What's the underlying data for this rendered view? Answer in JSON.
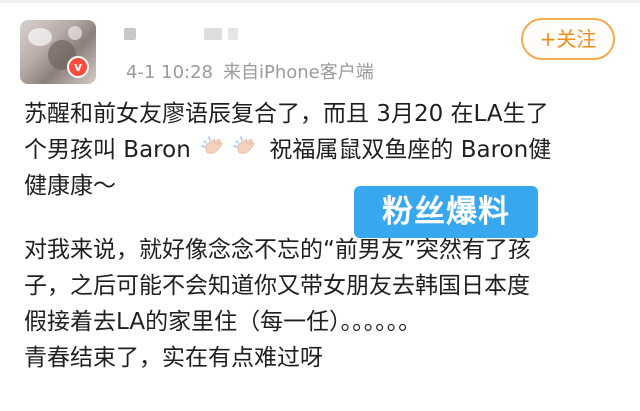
{
  "post": {
    "header": {
      "timestamp": "4-1 10:28",
      "source_prefix": "来自",
      "source_device": "iPhone客户端",
      "follow_label": "+关注"
    },
    "body": {
      "paragraph_1": {
        "line_1": "苏醒和前女友廖语辰复合了，而且 3月20 在LA生了",
        "line_2_prefix": "个男孩叫 Baron ",
        "line_2_suffix": " 祝福属鼠双鱼座的 Baron健",
        "line_3": "健康康～"
      },
      "badge": "粉丝爆料",
      "paragraph_2": {
        "line_1": "对我来说，就好像念念不忘的“前男友”突然有了孩",
        "line_2": "子，之后可能不会知道你又带女朋友去韩国日本度",
        "line_3": "假接着去LA的家里住（每一任）。。。。。。",
        "line_4": "青春结束了，实在有点难过呀"
      }
    },
    "colors": {
      "follow_border": "#f2ab4f",
      "follow_text": "#f08d1a",
      "meta_text": "#9a9a9a",
      "badge_bg": "#37a8f0",
      "verified_badge": "#ff4d3d"
    },
    "icons": {
      "verified": "verified-badge-icon",
      "emoji_1": "clapping-hands-icon",
      "emoji_2": "clapping-hands-icon"
    }
  }
}
